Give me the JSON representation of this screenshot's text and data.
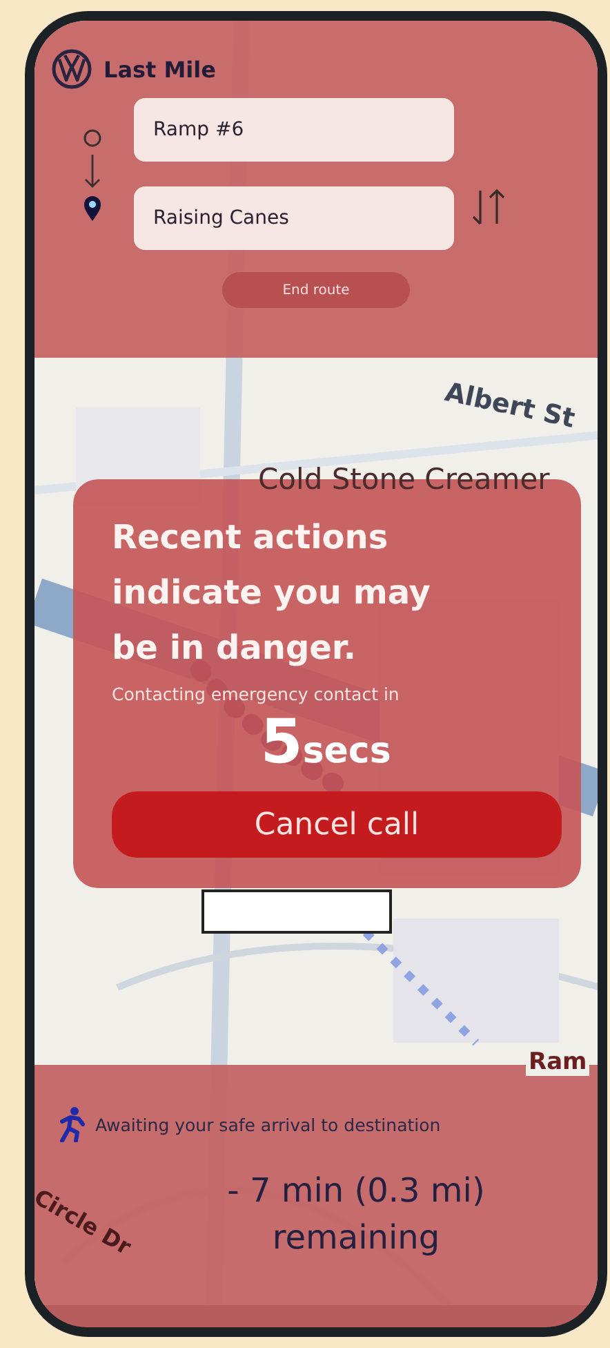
{
  "app": {
    "title": "Last Mile"
  },
  "route": {
    "origin": {
      "value": "Ramp #6"
    },
    "destination": {
      "value": "Raising Canes"
    },
    "end_button": "End route"
  },
  "map": {
    "labels": [
      {
        "text": "Albert St",
        "kind": "street"
      },
      {
        "text": "Cold Stone Creamer",
        "kind": "place"
      },
      {
        "text": "Circle Dr",
        "kind": "street"
      },
      {
        "text": "Ram",
        "kind": "stop"
      }
    ]
  },
  "alert": {
    "title": "Recent actions indicate you may be in danger.",
    "subtitle": "Contacting emergency contact in",
    "count": "5",
    "unit": "secs",
    "cancel_button": "Cancel call"
  },
  "status": {
    "message": "Awaiting your safe arrival to destination",
    "remaining": "- 7 min (0.3 mi) remaining"
  }
}
